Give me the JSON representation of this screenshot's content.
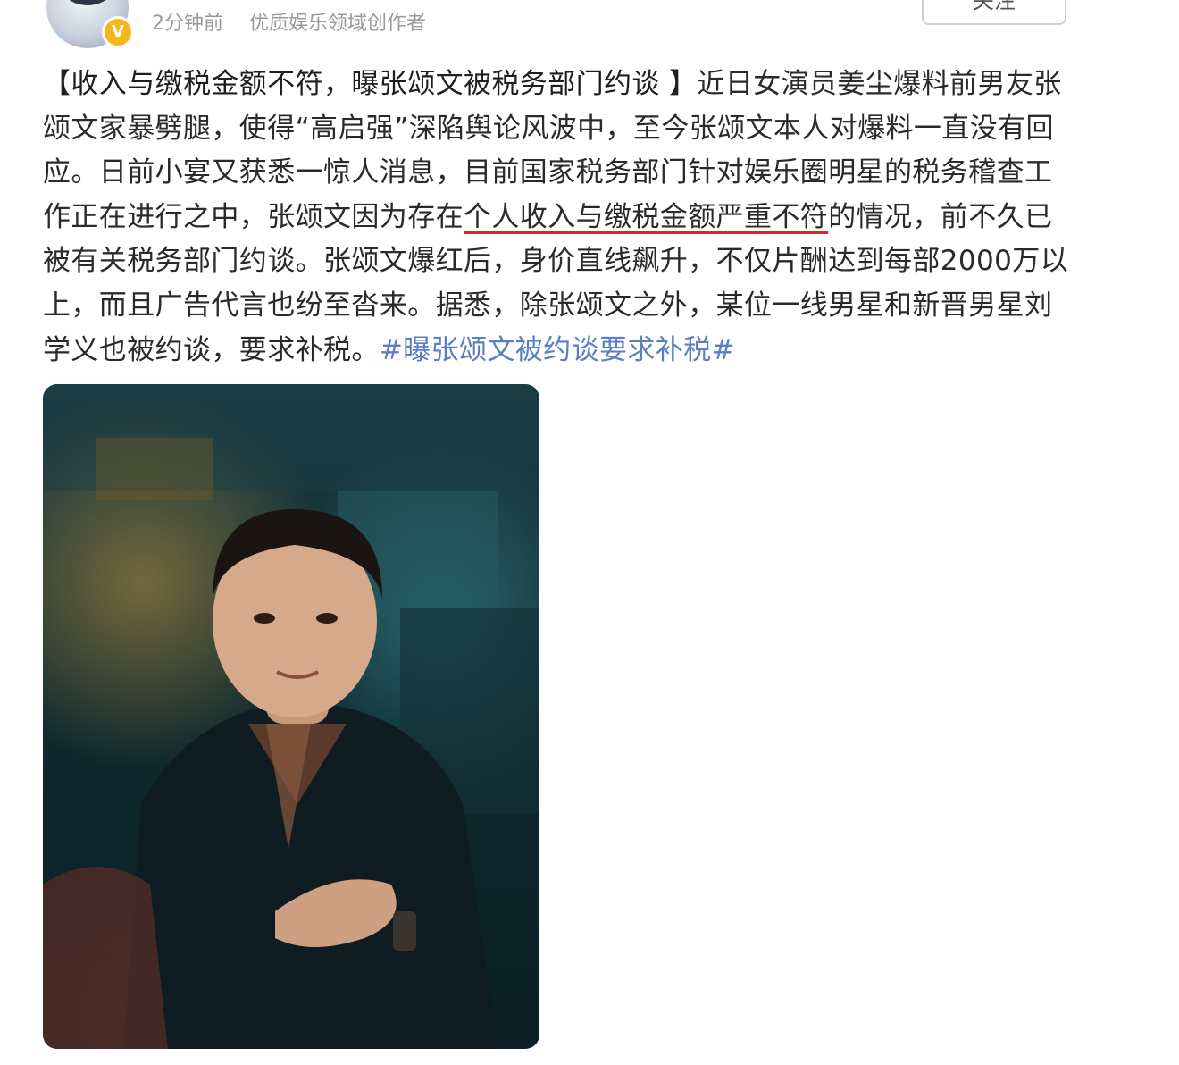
{
  "header": {
    "time": "2分钟前",
    "author_tag": "优质娱乐领域创作者",
    "follow_label": "关注",
    "verified_badge": "V",
    "avatar_icon": "user-avatar-icon",
    "badge_color": "#f5b81c"
  },
  "post": {
    "headline": "【收入与缴税金额不符，曝张颂文被税务部门约谈 】",
    "text_before_highlight": "近日女演员姜尘爆料前男友张颂文家暴劈腿，使得“高启强”深陷舆论风波中，至今张颂文本人对爆料一直没有回应。日前小宴又获悉一惊人消息，目前国家税务部门针对娱乐圈明星的税务稽查工作正在进行之中，张颂文因为存在",
    "highlight": "个人收入与缴税金额严重不符",
    "text_after_highlight": "的情况，前不久已被有关税务部门约谈。张颂文爆红后，身价直线飙升，不仅片酬达到每部2000万以上，而且广告代言也纷至沓来。据悉，除张颂文之外，某位一线男星和新晋男星刘学义也被约谈，要求补税。",
    "hashtag": "#曝张颂文被约谈要求补税#",
    "highlight_underline_color": "#d7262b",
    "hashtag_color": "#5b7fc2"
  },
  "image": {
    "description_icon": "photo-image"
  }
}
